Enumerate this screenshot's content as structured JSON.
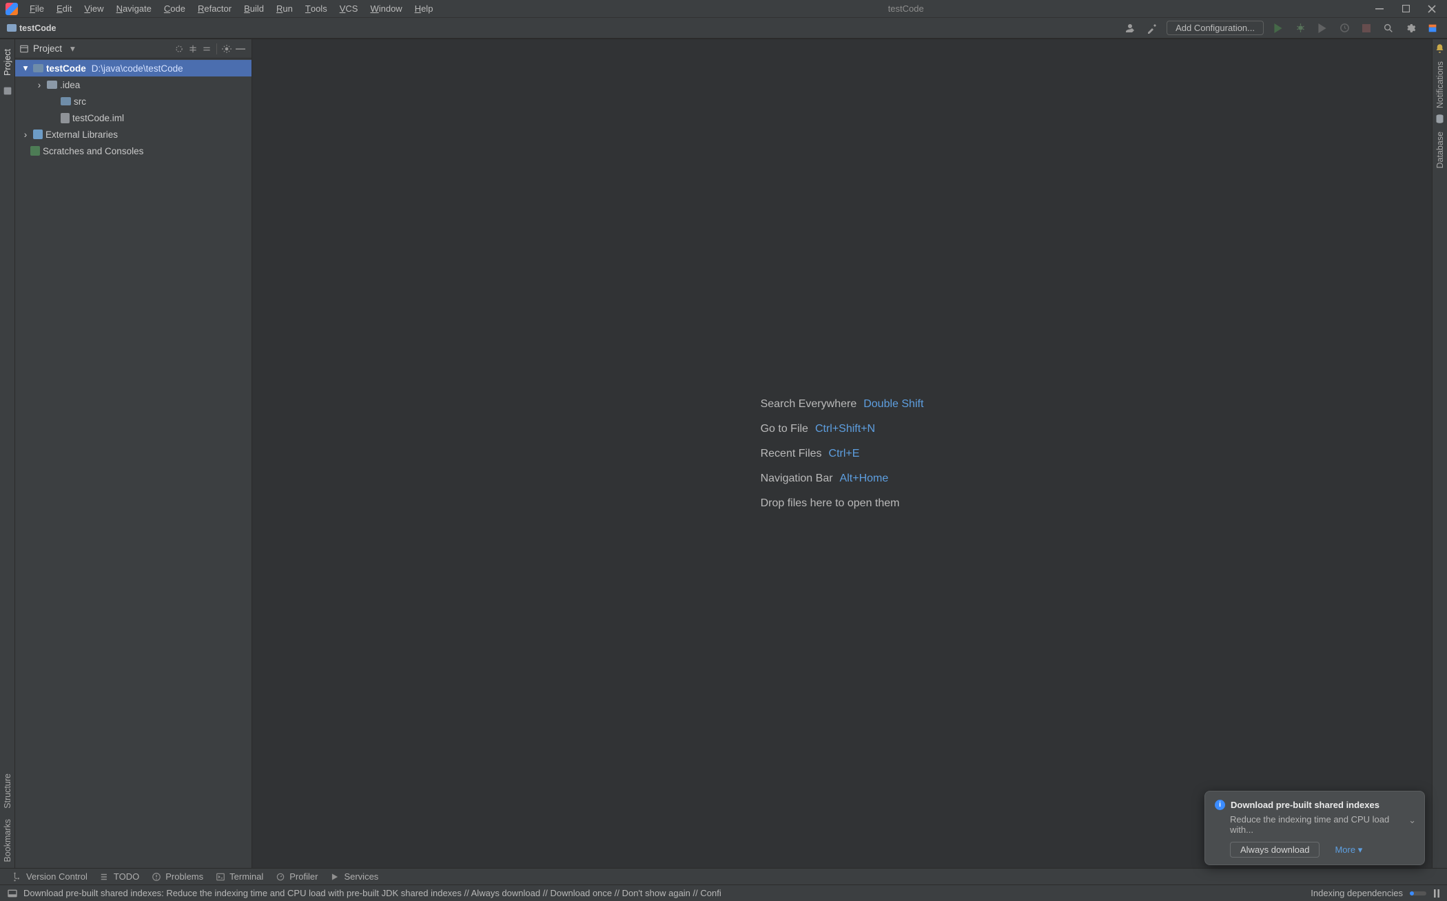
{
  "menu": [
    "File",
    "Edit",
    "View",
    "Navigate",
    "Code",
    "Refactor",
    "Build",
    "Run",
    "Tools",
    "VCS",
    "Window",
    "Help"
  ],
  "window_title": "testCode",
  "breadcrumb": {
    "project": "testCode"
  },
  "toolbar": {
    "add_config": "Add Configuration..."
  },
  "project_tw": {
    "title": "Project",
    "root": {
      "name": "testCode",
      "path": "D:\\java\\code\\testCode"
    },
    "children": [
      {
        "name": ".idea",
        "type": "folder",
        "expandable": true
      },
      {
        "name": "src",
        "type": "folder",
        "expandable": false
      },
      {
        "name": "testCode.iml",
        "type": "file"
      }
    ],
    "external_libs": "External Libraries",
    "scratches": "Scratches and Consoles"
  },
  "editor_hints": [
    {
      "label": "Search Everywhere",
      "shortcut": "Double Shift"
    },
    {
      "label": "Go to File",
      "shortcut": "Ctrl+Shift+N"
    },
    {
      "label": "Recent Files",
      "shortcut": "Ctrl+E"
    },
    {
      "label": "Navigation Bar",
      "shortcut": "Alt+Home"
    }
  ],
  "editor_drop": "Drop files here to open them",
  "left_tabs": {
    "project": "Project",
    "structure": "Structure",
    "bookmarks": "Bookmarks"
  },
  "right_tabs": {
    "notifications": "Notifications",
    "database": "Database"
  },
  "bottom_tabs": {
    "vcs": "Version Control",
    "todo": "TODO",
    "problems": "Problems",
    "terminal": "Terminal",
    "profiler": "Profiler",
    "services": "Services"
  },
  "status": {
    "message": "Download pre-built shared indexes: Reduce the indexing time and CPU load with pre-built JDK shared indexes // Always download // Download once // Don't show again // Confi",
    "indexing": "Indexing dependencies"
  },
  "notification": {
    "title": "Download pre-built shared indexes",
    "body": "Reduce the indexing time and CPU load with...",
    "primary": "Always download",
    "more": "More"
  }
}
